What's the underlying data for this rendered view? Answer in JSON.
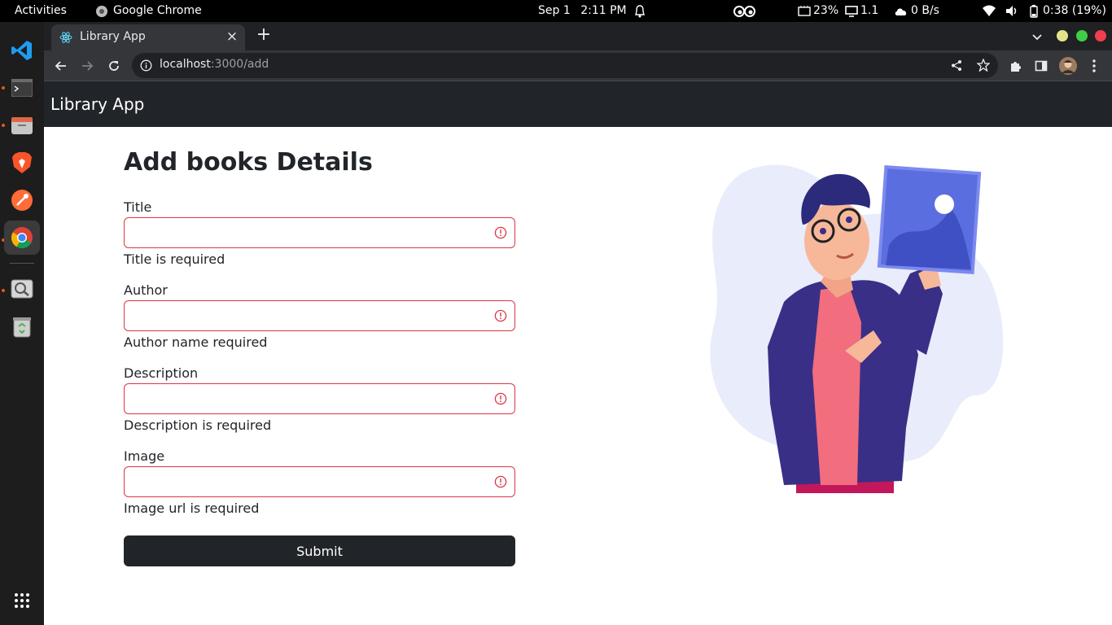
{
  "os_topbar": {
    "activities": "Activities",
    "app_name": "Google Chrome",
    "date": "Sep 1",
    "time": "2:11 PM",
    "cpu": "23%",
    "load": "1.1",
    "net": "0 B/s",
    "battery": "0:38 (19%)"
  },
  "dock": {
    "apps": [
      "vscode-icon",
      "terminal-icon",
      "files-icon",
      "brave-icon",
      "postman-icon",
      "chrome-icon",
      "image-viewer-icon",
      "trash-icon",
      "show-apps-icon"
    ]
  },
  "browser": {
    "tab_title": "Library App",
    "tab_close": "×",
    "new_tab": "+",
    "url_host": "localhost",
    "url_path": ":3000/add"
  },
  "app": {
    "brand": "Library App",
    "heading": "Add books Details",
    "fields": [
      {
        "label": "Title",
        "error": "Title is required",
        "value": ""
      },
      {
        "label": "Author",
        "error": "Author name required",
        "value": ""
      },
      {
        "label": "Description",
        "error": "Description is required",
        "value": ""
      },
      {
        "label": "Image",
        "error": "Image url is required",
        "value": ""
      }
    ],
    "submit_label": "Submit"
  },
  "colors": {
    "navbar": "#212529",
    "error": "#dc3545",
    "button": "#212529"
  }
}
